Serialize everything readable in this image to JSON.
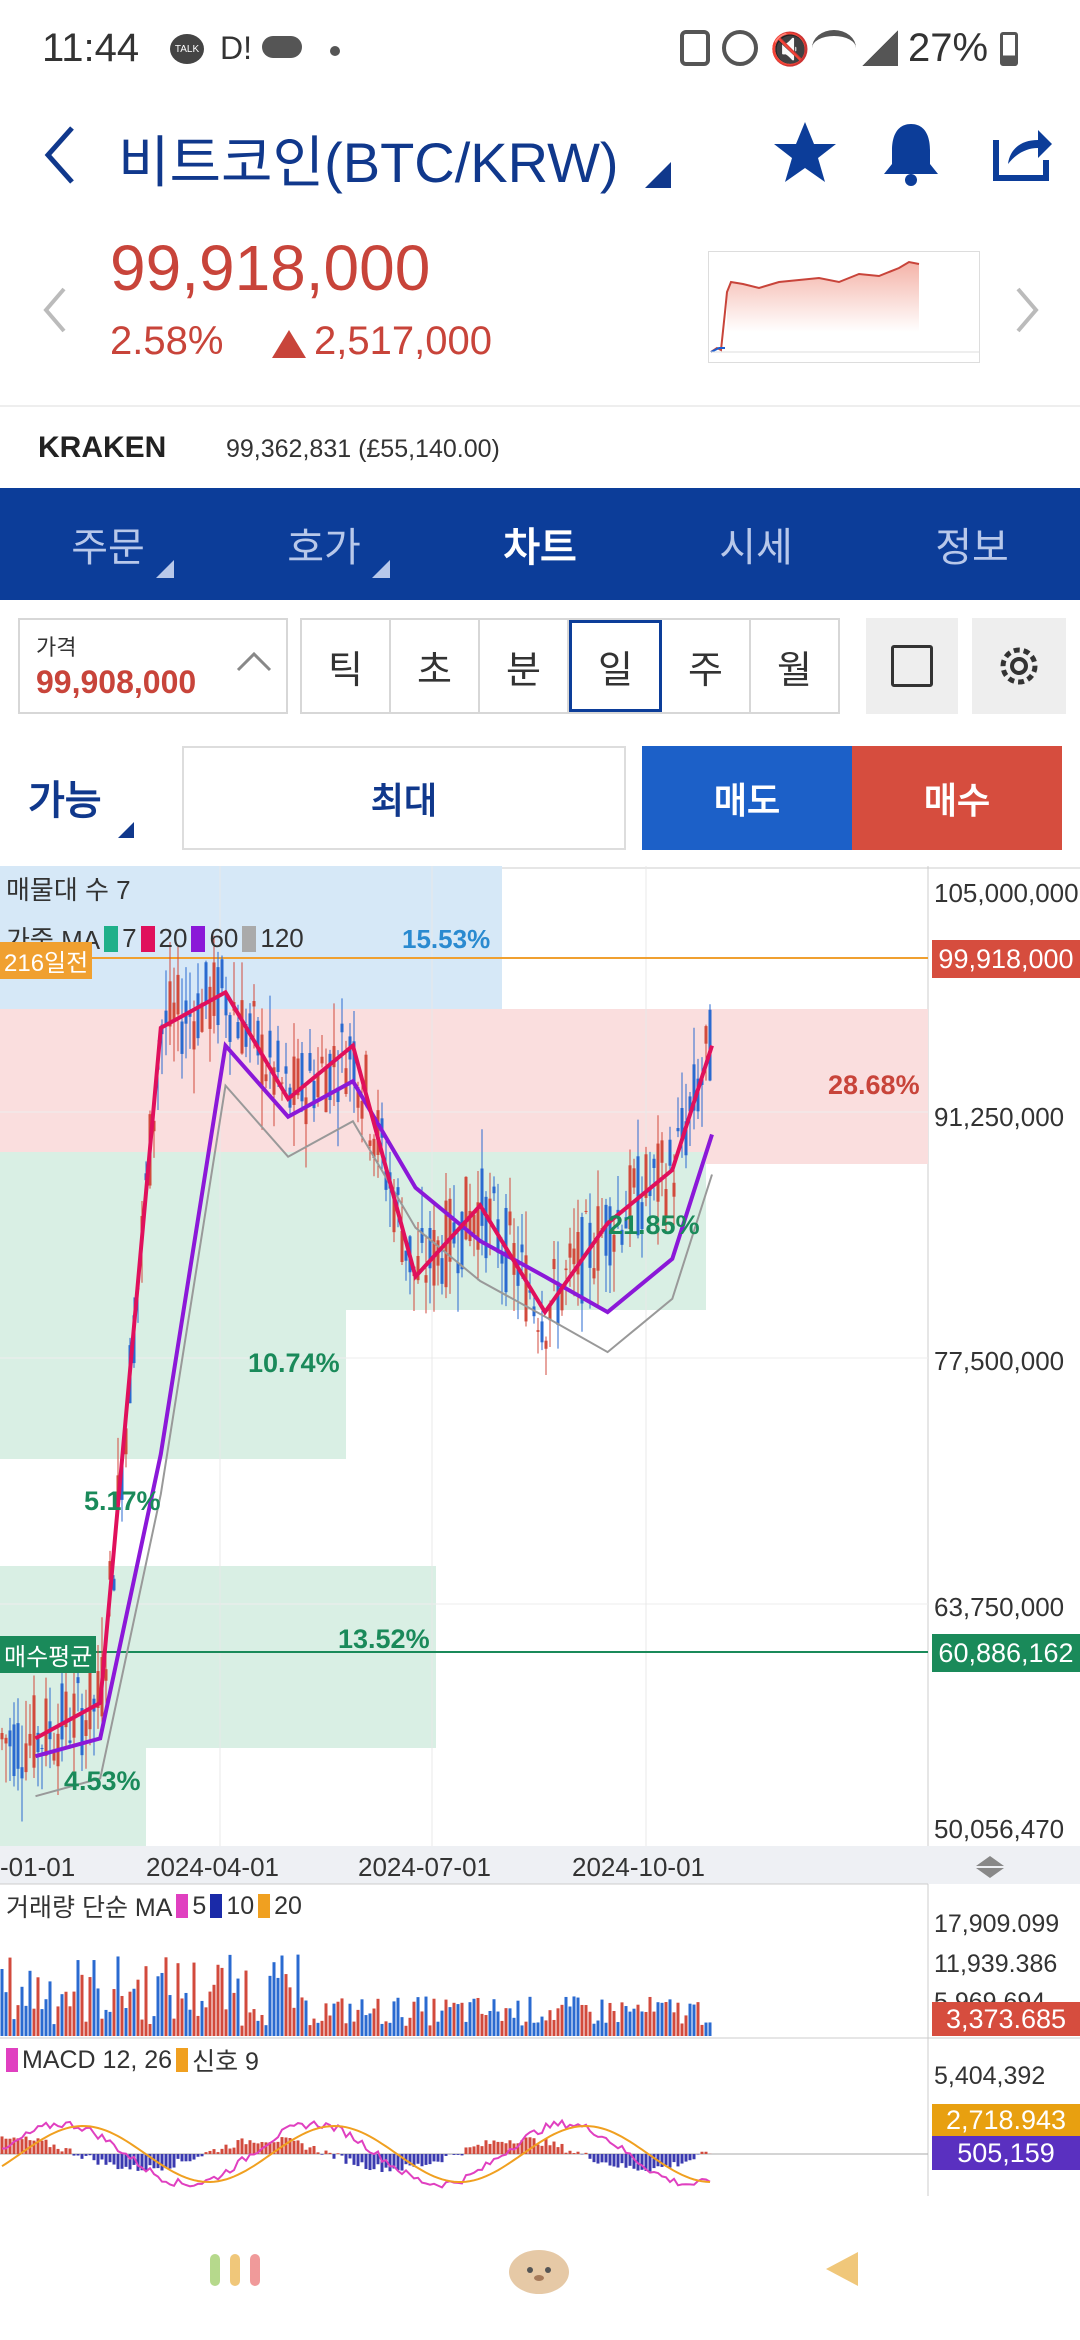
{
  "status": {
    "time": "11:44",
    "notif1": "TALK",
    "notif2": "D!",
    "battery": "27%"
  },
  "header": {
    "title": "비트코인(BTC/KRW)"
  },
  "price": {
    "current": "99,918,000",
    "change_pct": "2.58%",
    "change_abs": "2,517,000"
  },
  "kraken": {
    "label": "KRAKEN",
    "value": "99,362,831 (£55,140.00)"
  },
  "tabs": [
    {
      "label": "주문"
    },
    {
      "label": "호가"
    },
    {
      "label": "차트"
    },
    {
      "label": "시세"
    },
    {
      "label": "정보"
    }
  ],
  "controls": {
    "price_label": "가격",
    "price_value": "99,908,000",
    "periods": [
      "틱",
      "초",
      "분",
      "일",
      "주",
      "월"
    ],
    "selected_period": "일"
  },
  "order": {
    "avail": "가능",
    "max": "최대",
    "sell": "매도",
    "buy": "매수"
  },
  "chart_data": {
    "type": "line",
    "title": "",
    "overlay_labels": {
      "volume_profile": "매물대 수 7",
      "ma_label": "가중 MA",
      "ma_periods": [
        "7",
        "20",
        "60",
        "120"
      ],
      "range_tag": "216일전",
      "avg_buy_tag": "매수평균"
    },
    "profile_pcts": [
      "15.53%",
      "28.68%",
      "21.85%",
      "10.74%",
      "5.17%",
      "13.52%",
      "4.53%"
    ],
    "y_ticks": [
      "105,000,000",
      "91,250,000",
      "77,500,000",
      "63,750,000",
      "50,056,470"
    ],
    "x_ticks": [
      "-01-01",
      "2024-04-01",
      "2024-07-01",
      "2024-10-01"
    ],
    "current_price": "99,918,000",
    "avg_buy_price": "60,886,162",
    "ylim": [
      50056470,
      105000000
    ],
    "series": [
      {
        "name": "MA 7",
        "color": "#e0105c",
        "x": [
          "2024-01-01",
          "2024-02-01",
          "2024-03-01",
          "2024-04-01",
          "2024-05-01",
          "2024-06-01",
          "2024-07-01",
          "2024-08-01",
          "2024-09-01",
          "2024-10-01",
          "2024-11-01",
          "2024-11-20"
        ],
        "values": [
          56000000,
          58000000,
          96000000,
          98000000,
          92000000,
          95000000,
          82000000,
          86000000,
          80000000,
          85000000,
          88000000,
          95000000
        ]
      },
      {
        "name": "MA 60",
        "color": "#8b18d8",
        "x": [
          "2024-01-01",
          "2024-02-01",
          "2024-03-01",
          "2024-04-01",
          "2024-05-01",
          "2024-06-01",
          "2024-07-01",
          "2024-08-01",
          "2024-09-01",
          "2024-10-01",
          "2024-11-01",
          "2024-11-20"
        ],
        "values": [
          55000000,
          56000000,
          72000000,
          95000000,
          91000000,
          93000000,
          87000000,
          84000000,
          82000000,
          80000000,
          83000000,
          90000000
        ]
      }
    ],
    "volume": {
      "label": "거래량 단순 MA",
      "ma": [
        "5",
        "10",
        "20"
      ],
      "ticks": [
        "17,909.099",
        "11,939.386",
        "5,969.694"
      ],
      "last": "3,373.685"
    },
    "macd": {
      "label": "MACD 12, 26",
      "signal_label": "신호 9",
      "ticks": [
        "5,404,392"
      ],
      "macd_val": "2,718.943",
      "signal_val": "505,159"
    }
  },
  "colors": {
    "navy": "#0c3d99",
    "up": "#d24a3c",
    "down": "#1a5ed0"
  }
}
